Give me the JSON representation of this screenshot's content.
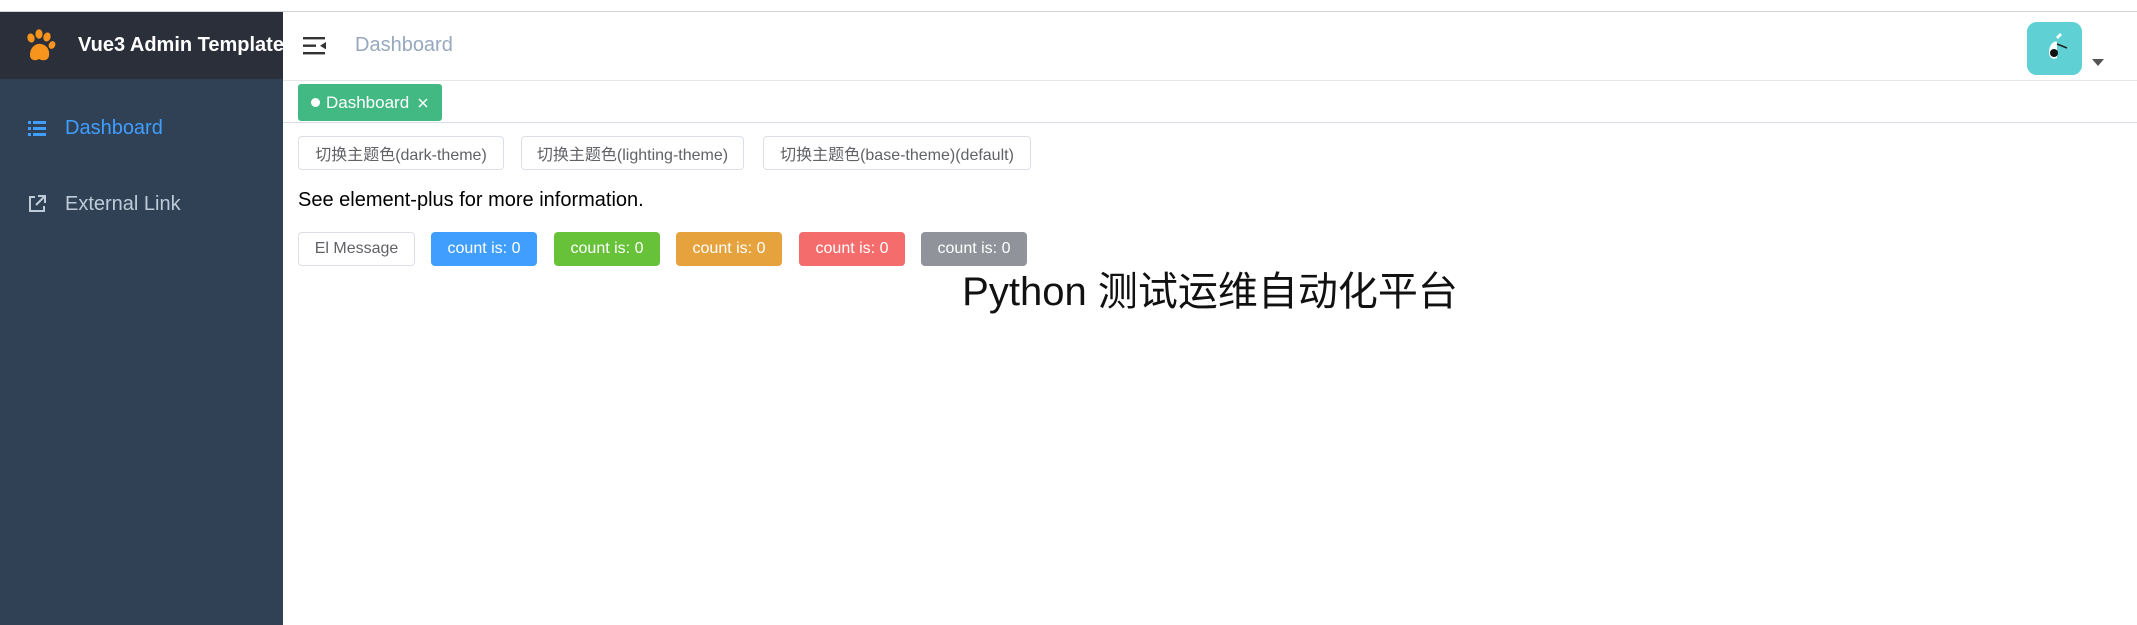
{
  "app": {
    "title": "Vue3 Admin Template"
  },
  "sidebar": {
    "items": [
      {
        "label": "Dashboard",
        "icon": "list-icon",
        "active": true
      },
      {
        "label": "External Link",
        "icon": "external-link-icon",
        "active": false
      }
    ]
  },
  "header": {
    "breadcrumb": "Dashboard"
  },
  "tags": {
    "active_label": "Dashboard"
  },
  "theme_buttons": [
    "切换主题色(dark-theme)",
    "切换主题色(lighting-theme)",
    "切换主题色(base-theme)(default)"
  ],
  "info_text": "See element-plus for more information.",
  "message_button": "El Message",
  "count_buttons": [
    {
      "label": "count is: 0",
      "type": "primary"
    },
    {
      "label": "count is: 0",
      "type": "success"
    },
    {
      "label": "count is: 0",
      "type": "warning"
    },
    {
      "label": "count is: 0",
      "type": "danger"
    },
    {
      "label": "count is: 0",
      "type": "info"
    }
  ],
  "main_title": "Python 测试运维自动化平台",
  "colors": {
    "sidebar_bg": "#304156",
    "logo_bar_bg": "#2b2f3a",
    "active_menu": "#409eff",
    "tag_active": "#42b983",
    "logo_orange": "#f7941d",
    "avatar_bg": "#5fd0d3"
  }
}
